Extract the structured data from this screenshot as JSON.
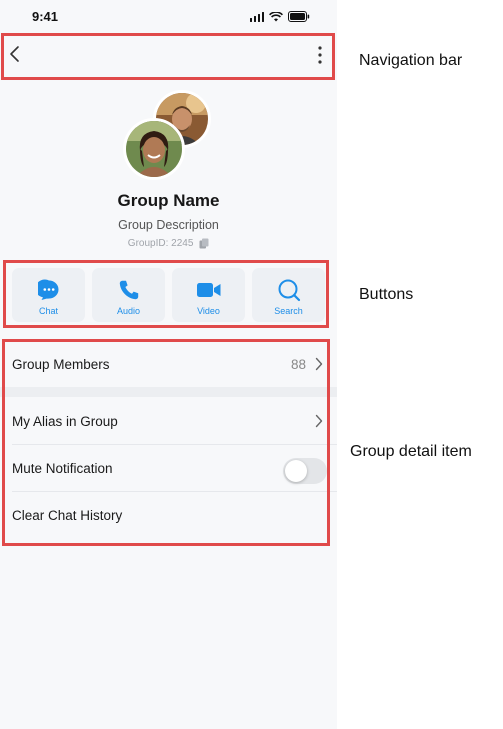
{
  "status_bar": {
    "time": "9:41",
    "icons": [
      "signal-icon",
      "wifi-icon",
      "battery-icon"
    ]
  },
  "nav_bar": {
    "back_icon": "chevron-left-icon",
    "more_icon": "more-vertical-icon"
  },
  "profile": {
    "name": "Group Name",
    "description": "Group Description",
    "group_id": "GroupID: 2245",
    "copy_icon": "copy-icon"
  },
  "actions": [
    {
      "label": "Chat",
      "icon": "chat-bubble-icon"
    },
    {
      "label": "Audio",
      "icon": "phone-icon"
    },
    {
      "label": "Video",
      "icon": "video-camera-icon"
    },
    {
      "label": "Search",
      "icon": "search-icon"
    }
  ],
  "details": {
    "members": {
      "label": "Group Members",
      "count": "88"
    },
    "alias": {
      "label": "My Alias in Group"
    },
    "mute": {
      "label": "Mute Notification",
      "enabled": false
    },
    "clear": {
      "label": "Clear Chat History"
    }
  },
  "annotations": {
    "nav": "Navigation bar",
    "buttons": "Buttons",
    "details": "Group detail item"
  },
  "colors": {
    "accent": "#1e8ee8",
    "annotation_border": "#e04a4a",
    "background": "#f7f8fa"
  }
}
